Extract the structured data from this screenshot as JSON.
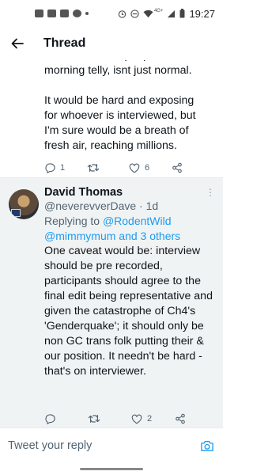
{
  "status_bar": {
    "time": "19:27",
    "network": "4G+",
    "icons": [
      "notification-icon",
      "image-icon",
      "youtube-icon",
      "play-icon",
      "dot-icon",
      "alarm-icon",
      "dnd-icon",
      "wifi-icon",
      "signal-icon",
      "battery-icon"
    ]
  },
  "header": {
    "title": "Thread",
    "back_icon": "arrow-left-icon"
  },
  "tweet1": {
    "text": "that affect trans people, on\nmorning telly, isnt just normal.\n\nIt would be hard and exposing\nfor whoever is interviewed, but\nI'm sure would be a breath of\nfresh air, reaching millions.",
    "replies": "1",
    "retweets": "",
    "likes": "6"
  },
  "tweet2": {
    "name": "David Thomas",
    "handle": "@neverevverDave",
    "dot": "·",
    "time": "1d",
    "replying_prefix": "Replying to",
    "replying_user1": "@RodentWild",
    "replying_user2_and_others": "@mimmymum and 3 others",
    "text": "One caveat would be: interview should be pre recorded, participants should agree to the final edit being representative and given the catastrophe of Ch4's 'Genderquake'; it should only be non GC trans folk putting their & our position. It needn't be hard - that's on interviewer.",
    "replies": "",
    "retweets": "",
    "likes": "2"
  },
  "compose": {
    "placeholder": "Tweet your reply",
    "camera_icon": "camera-icon"
  },
  "colors": {
    "accent": "#1d9bf0",
    "text": "#0f1419",
    "secondary": "#536471",
    "highlight_bg": "#f0f3f4"
  }
}
